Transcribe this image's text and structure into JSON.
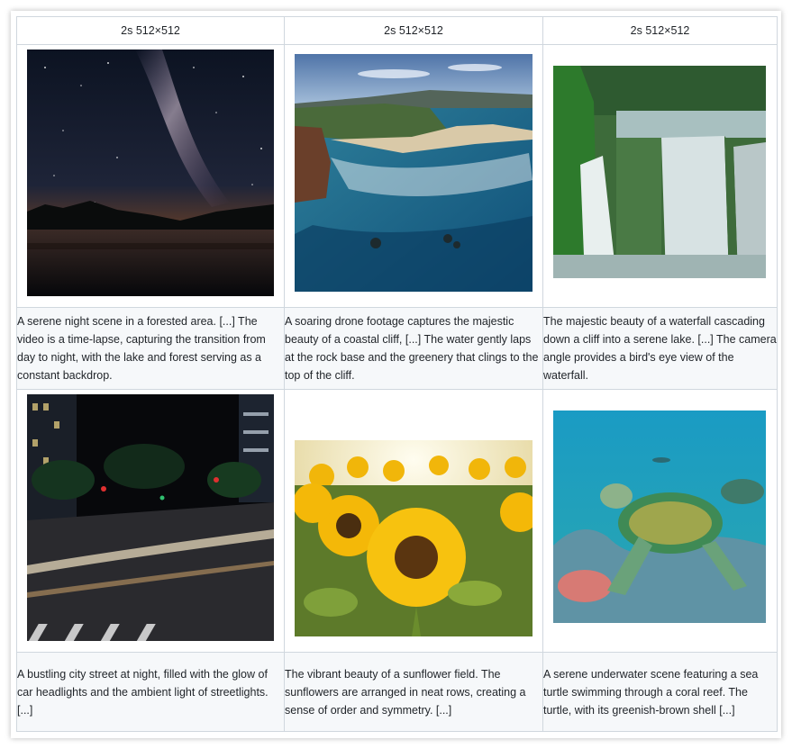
{
  "table": {
    "headers": [
      "2s 512×512",
      "2s 512×512",
      "2s 512×512"
    ],
    "rows": [
      {
        "items": [
          {
            "icon": "night-sky-lake-image",
            "caption": "A serene night scene in a forested area. [...] The video is a time-lapse, capturing the transition from day to night, with the lake and forest serving as a constant backdrop."
          },
          {
            "icon": "coastal-cliff-image",
            "caption": "A soaring drone footage captures the majestic beauty of a coastal cliff, [...] The water gently laps at the rock base and the greenery that clings to the top of the cliff."
          },
          {
            "icon": "waterfall-image",
            "caption": "The majestic beauty of a waterfall cascading down a cliff into a serene lake. [...] The camera angle provides a bird's eye view of the waterfall."
          }
        ]
      },
      {
        "items": [
          {
            "icon": "city-street-night-image",
            "caption": "A bustling city street at night, filled with the glow of car headlights and the ambient light of streetlights. [...]"
          },
          {
            "icon": "sunflower-field-image",
            "caption": "The vibrant beauty of a sunflower field. The sunflowers are arranged in neat rows, creating a sense of order and symmetry. [...]"
          },
          {
            "icon": "sea-turtle-image",
            "caption": "A serene underwater scene featuring a sea turtle swimming through a coral reef. The turtle, with its greenish-brown shell [...]"
          }
        ]
      }
    ]
  }
}
